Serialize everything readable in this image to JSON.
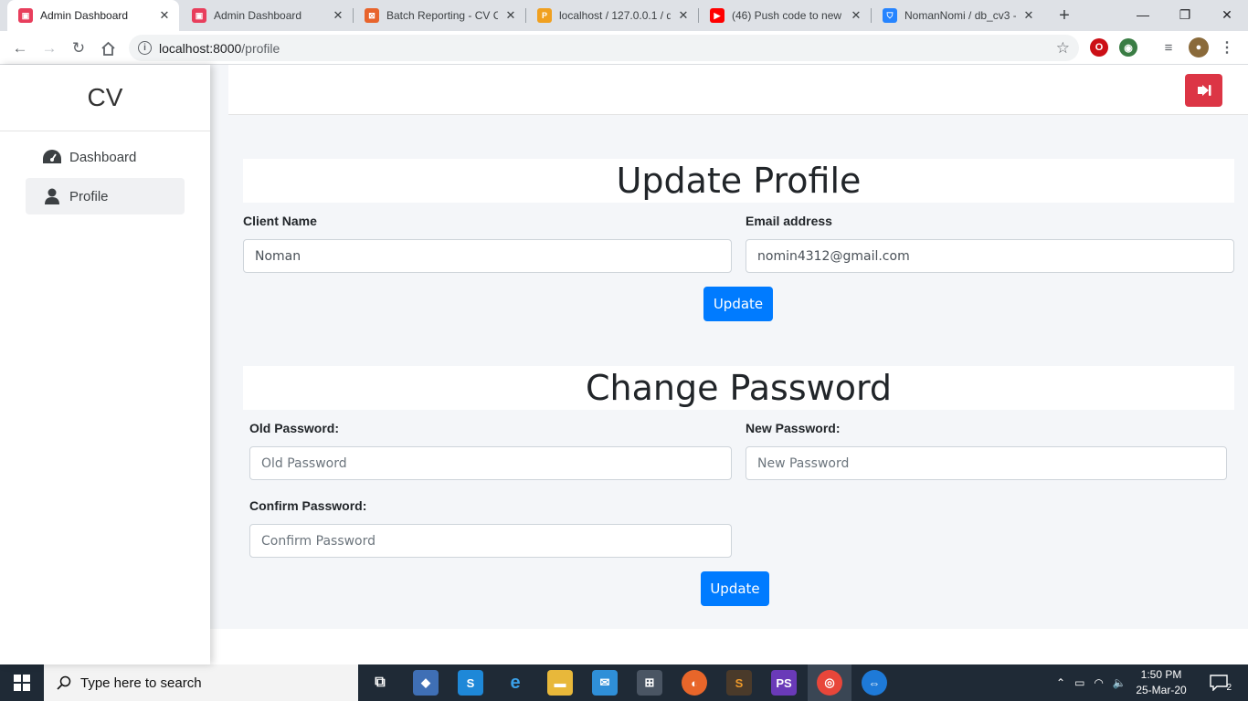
{
  "browser": {
    "tabs": [
      {
        "title": "Admin Dashboard",
        "active": true,
        "favicon_color": "#e83e5c"
      },
      {
        "title": "Admin Dashboard",
        "active": false,
        "favicon_color": "#e83e5c"
      },
      {
        "title": "Batch Reporting - CV C",
        "active": false,
        "favicon_color": "#e8642c"
      },
      {
        "title": "localhost / 127.0.0.1 / d",
        "active": false,
        "favicon_color": "#f0a020"
      },
      {
        "title": "(46) Push code to new r",
        "active": false,
        "favicon_color": "#ff0000"
      },
      {
        "title": "NomanNomi / db_cv3 -",
        "active": false,
        "favicon_color": "#2684ff"
      }
    ],
    "address": {
      "host": "localhost:8000",
      "path": "/profile"
    }
  },
  "sidebar": {
    "brand": "CV",
    "items": [
      {
        "label": "Dashboard",
        "icon": "tachometer-icon",
        "active": false
      },
      {
        "label": "Profile",
        "icon": "user-icon",
        "active": true
      }
    ]
  },
  "update_profile": {
    "title": "Update Profile",
    "client_name_label": "Client Name",
    "client_name_value": "Noman",
    "email_label": "Email address",
    "email_value": "nomin4312@gmail.com",
    "button": "Update"
  },
  "change_password": {
    "title": "Change Password",
    "old_label": "Old Password:",
    "old_placeholder": "Old Password",
    "new_label": "New Password:",
    "new_placeholder": "New Password",
    "confirm_label": "Confirm Password:",
    "confirm_placeholder": "Confirm Password",
    "button": "Update"
  },
  "colors": {
    "primary": "#007bff",
    "danger": "#dc3545",
    "taskbar": "#1f2a36"
  },
  "taskbar": {
    "search_placeholder": "Type here to search",
    "time": "1:50 PM",
    "date": "25-Mar-20",
    "notification_count": "2"
  }
}
